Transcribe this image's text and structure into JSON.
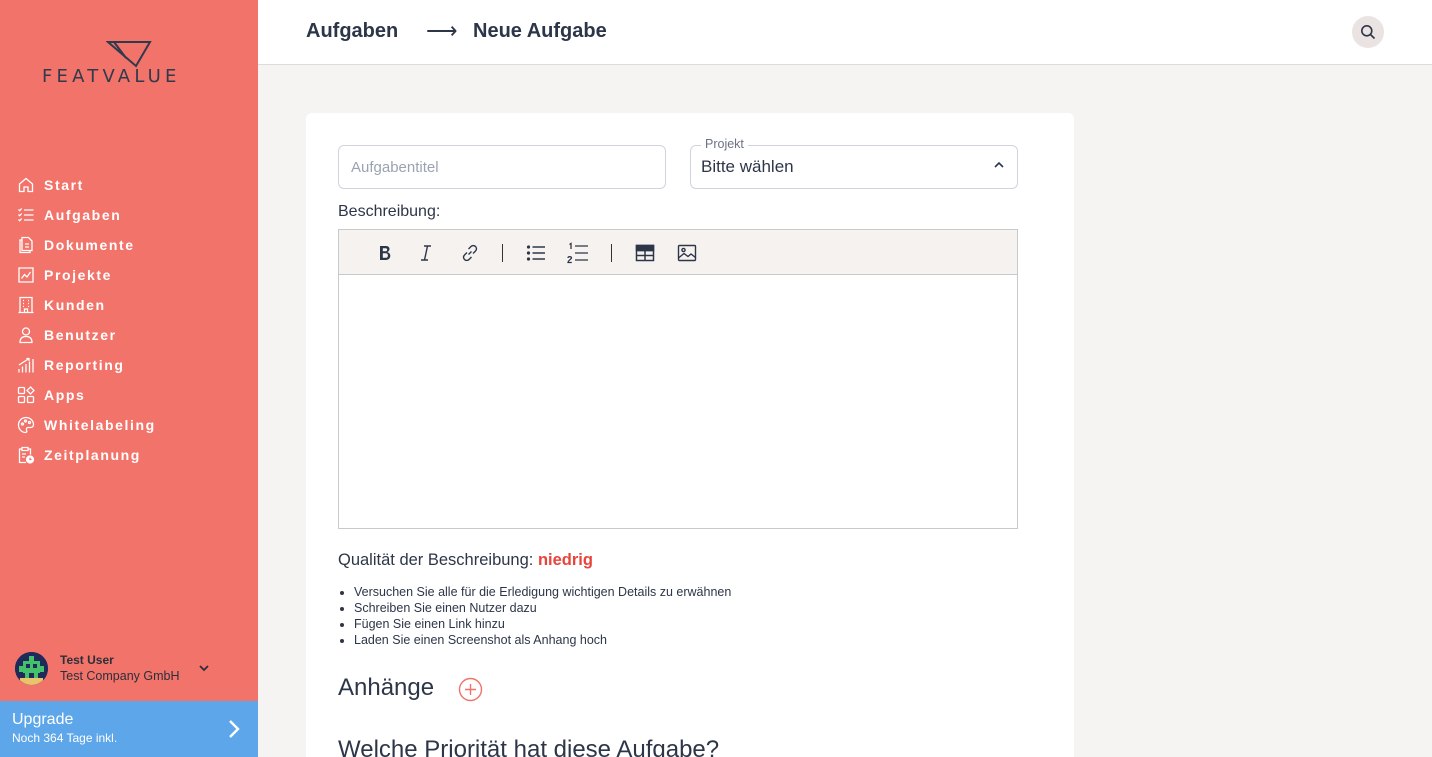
{
  "brand": {
    "name": "FEATVALUE"
  },
  "sidebar": {
    "items": [
      {
        "label": "Start",
        "icon": "home-icon"
      },
      {
        "label": "Aufgaben",
        "icon": "tasks-icon"
      },
      {
        "label": "Dokumente",
        "icon": "document-icon"
      },
      {
        "label": "Projekte",
        "icon": "chart-icon"
      },
      {
        "label": "Kunden",
        "icon": "building-icon"
      },
      {
        "label": "Benutzer",
        "icon": "user-icon"
      },
      {
        "label": "Reporting",
        "icon": "bar-chart-icon"
      },
      {
        "label": "Apps",
        "icon": "apps-icon"
      },
      {
        "label": "Whitelabeling",
        "icon": "palette-icon"
      },
      {
        "label": "Zeitplanung",
        "icon": "clipboard-clock-icon"
      }
    ],
    "user": {
      "name": "Test User",
      "company": "Test Company GmbH"
    },
    "upgrade": {
      "title": "Upgrade",
      "subtitle": "Noch 364 Tage inkl."
    }
  },
  "header": {
    "breadcrumb": [
      "Aufgaben",
      "Neue Aufgabe"
    ],
    "arrow": "⟶"
  },
  "form": {
    "title_placeholder": "Aufgabentitel",
    "project": {
      "legend": "Projekt",
      "value": "Bitte wählen"
    },
    "description_label": "Beschreibung:",
    "quality_label": "Qualität der Beschreibung:",
    "quality_value": "niedrig",
    "tips": [
      "Versuchen Sie alle für die Erledigung wichtigen Details zu erwähnen",
      "Schreiben Sie einen Nutzer dazu",
      "Fügen Sie einen Link hinzu",
      "Laden Sie einen Screenshot als Anhang hoch"
    ],
    "attachments_title": "Anhänge",
    "priority_title": "Welche Priorität hat diese Aufgabe?"
  },
  "colors": {
    "sidebar": "#f2736a",
    "upgrade": "#5ea6ea",
    "quality_low": "#e8443c"
  }
}
